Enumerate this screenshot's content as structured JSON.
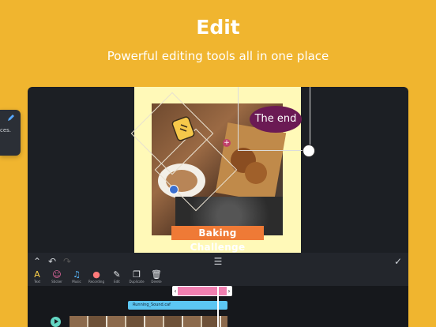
{
  "promo": {
    "title": "Edit",
    "subtitle": "Powerful editing tools all in one place"
  },
  "side_panel": {
    "text": "ces."
  },
  "canvas": {
    "banner_text": "Baking Challenge",
    "bubble_text": "The end"
  },
  "tools": [
    {
      "label": "Text",
      "icon": "text-icon",
      "color": "#ffd24a"
    },
    {
      "label": "Sticker",
      "icon": "sticker-icon",
      "color": "#f06aa6"
    },
    {
      "label": "Music",
      "icon": "music-icon",
      "color": "#58b9ff"
    },
    {
      "label": "Recording",
      "icon": "microphone-icon",
      "color": "#ff7a7a"
    },
    {
      "label": "Edit",
      "icon": "pencil-icon",
      "color": "#e9ecef"
    },
    {
      "label": "Duplicate",
      "icon": "duplicate-icon",
      "color": "#e9ecef"
    },
    {
      "label": "Delete",
      "icon": "trash-icon",
      "color": "#e9ecef"
    }
  ],
  "timeline": {
    "audio_clip": "Running_Sound.caf"
  },
  "colors": {
    "background": "#f0b52f",
    "panel": "#1c1f24",
    "accent_pink": "#f07fb0",
    "accent_blue": "#5cc6f2"
  }
}
